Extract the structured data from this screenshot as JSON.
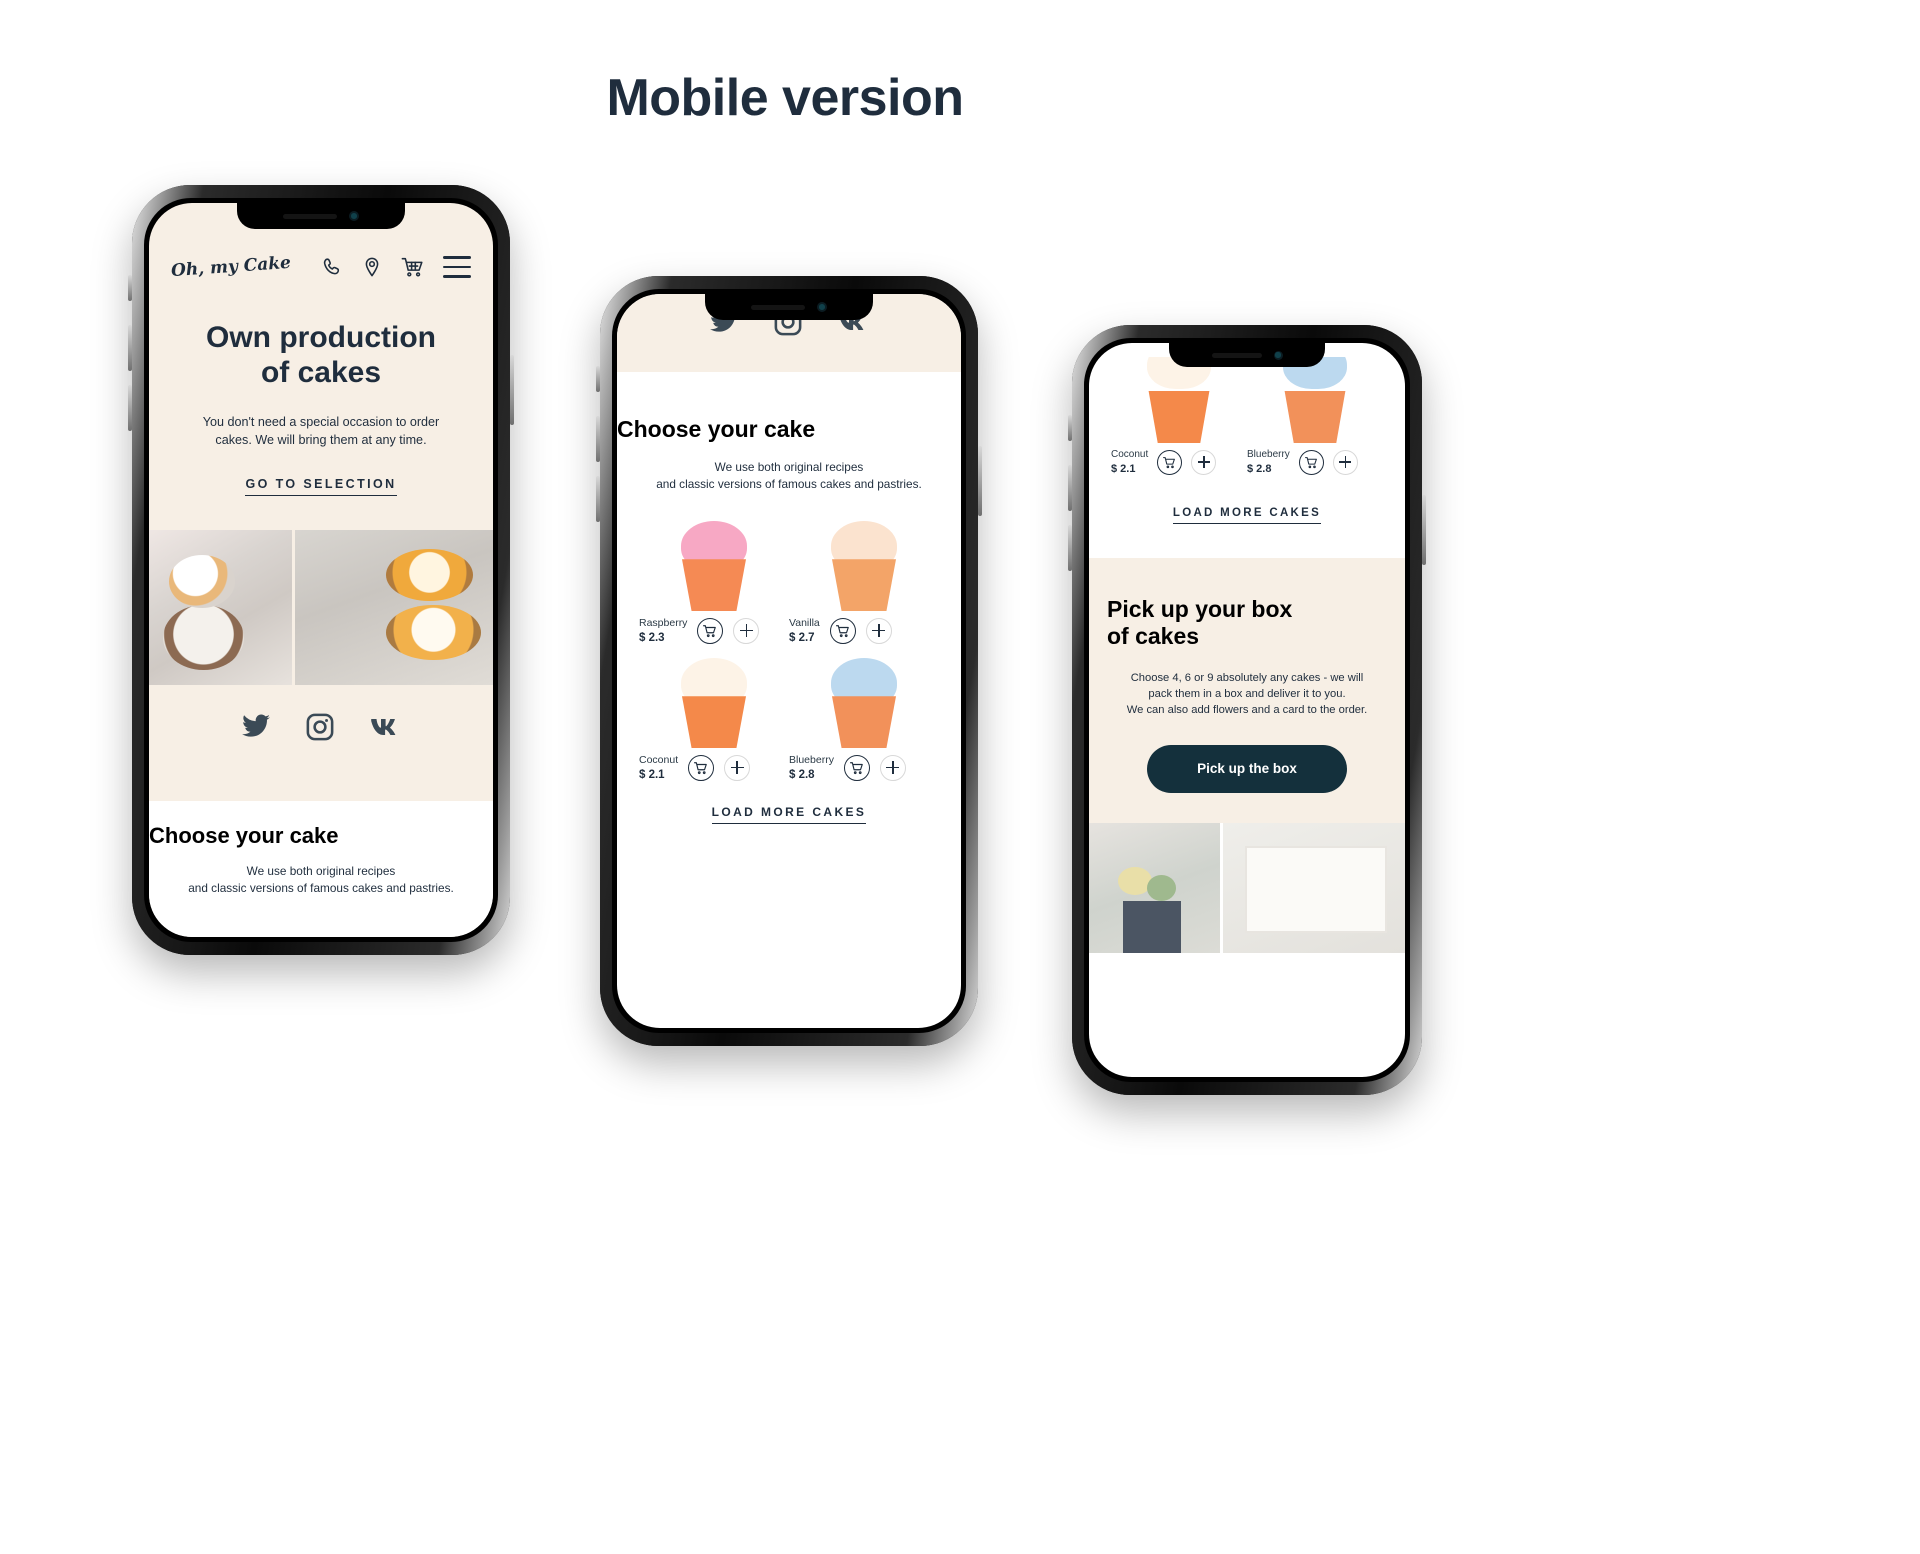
{
  "page": {
    "title": "Mobile version"
  },
  "brand": {
    "accent_dark": "#1f2d3d",
    "cream": "#f7efe5",
    "logo": "Oh, my Cake"
  },
  "phone1": {
    "header": {
      "logo": "Oh, my Cake",
      "icons": [
        "phone-icon",
        "location-pin-icon",
        "shopping-cart-icon",
        "hamburger-menu-icon"
      ]
    },
    "hero": {
      "title_line1": "Own production",
      "title_line2": "of cakes",
      "paragraph_line1": "You don't need a special occasion to order",
      "paragraph_line2": "cakes. We will bring them at any time.",
      "cta": "GO TO SELECTION"
    },
    "socials": [
      "twitter-icon",
      "instagram-icon",
      "vk-icon"
    ],
    "section": {
      "title": "Choose your cake",
      "paragraph_line1": "We use both original recipes",
      "paragraph_line2": "and classic versions of famous cakes and pastries."
    }
  },
  "phone2": {
    "socials": [
      "twitter-icon",
      "instagram-icon",
      "vk-icon"
    ],
    "section": {
      "title": "Choose your cake",
      "paragraph_line1": "We use both original recipes",
      "paragraph_line2": "and classic versions of famous cakes and pastries."
    },
    "products": [
      {
        "name": "Raspberry",
        "price": "$ 2.3",
        "frosting": "#f7a8c4",
        "cup": "#f58a54"
      },
      {
        "name": "Vanilla",
        "price": "$ 2.7",
        "frosting": "#fbe3cf",
        "cup": "#f3a468"
      },
      {
        "name": "Coconut",
        "price": "$ 2.1",
        "frosting": "#fdf3e7",
        "cup": "#f4894a"
      },
      {
        "name": "Blueberry",
        "price": "$ 2.8",
        "frosting": "#bcd9ef",
        "cup": "#f2915a"
      }
    ],
    "cart_icon": "shopping-cart-icon",
    "add_icon": "plus-icon",
    "load_more": "LOAD MORE CAKES"
  },
  "phone3": {
    "products": [
      {
        "name": "Coconut",
        "price": "$ 2.1",
        "frosting": "#fdf3e7",
        "cup": "#f4894a"
      },
      {
        "name": "Blueberry",
        "price": "$ 2.8",
        "frosting": "#bcd9ef",
        "cup": "#f2915a"
      }
    ],
    "cart_icon": "shopping-cart-icon",
    "add_icon": "plus-icon",
    "load_more": "LOAD MORE CAKES",
    "promo": {
      "title_line1": "Pick up your box",
      "title_line2": "of cakes",
      "paragraph_line1": "Choose 4, 6 or 9 absolutely any cakes - we will",
      "paragraph_line2": "pack them in a box and deliver it to you.",
      "paragraph_line3": "We can also add flowers and a card to the order.",
      "button": "Pick up the box"
    }
  }
}
